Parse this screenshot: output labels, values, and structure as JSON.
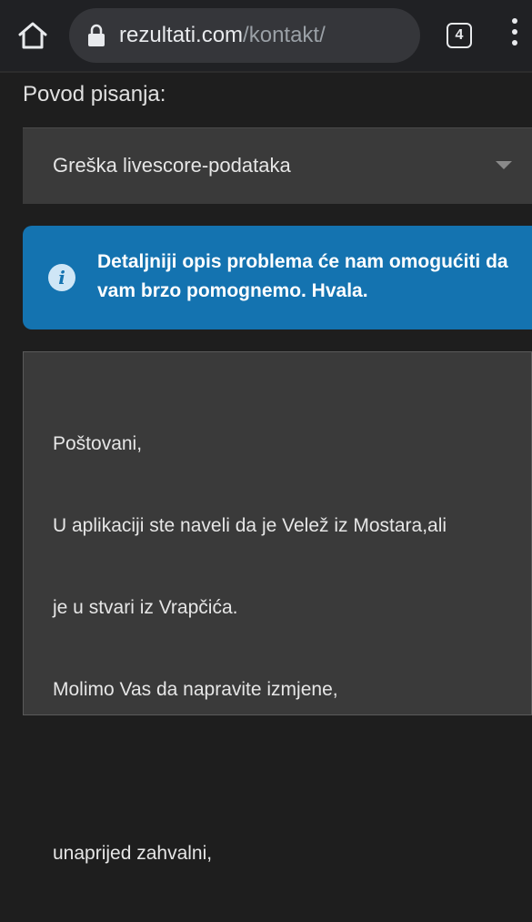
{
  "browser": {
    "url_domain": "rezultati.com",
    "url_path": "/kontakt/",
    "tab_count": "4"
  },
  "form": {
    "reason_label": "Povod pisanja:",
    "reason_selected": "Greška livescore-podataka",
    "info_message": "Detaljniji opis problema će nam omogućiti da vam brzo pomognemo. Hvala.",
    "message_lines": [
      "Poštovani,",
      "U aplikaciji ste naveli da je Velež iz Mostara,ali",
      "je u stvari iz Vrapčića.",
      "Molimo Vas da napravite izmjene,",
      "",
      "unaprijed zahvalni,"
    ]
  },
  "colors": {
    "background": "#1e1e1e",
    "info_accent": "#1473b0",
    "field_background": "#3a3a3a"
  },
  "icons": [
    "home-icon",
    "lock-icon",
    "tabs-icon",
    "more-vert-icon",
    "caret-down-icon",
    "info-icon"
  ]
}
